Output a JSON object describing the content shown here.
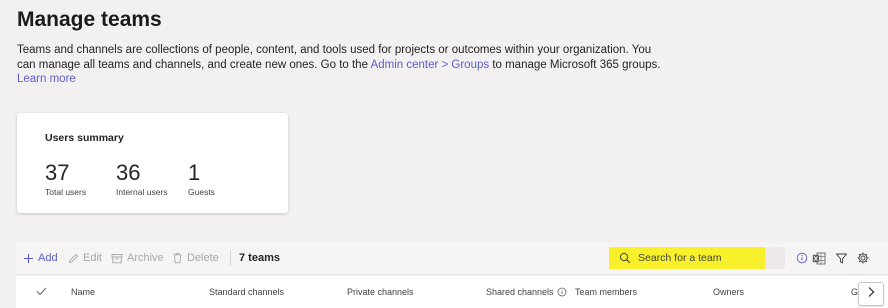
{
  "page": {
    "title": "Manage teams",
    "intro_line1": "Teams and channels are collections of people, content, and tools used for projects or outcomes within your organization. You",
    "intro_line2_pre": "can manage all teams and channels, and create new ones. Go to the ",
    "intro_link": "Admin center > Groups",
    "intro_line2_post": " to manage Microsoft 365 groups.",
    "learn_more": "Learn more"
  },
  "summary": {
    "title": "Users summary",
    "stats": [
      {
        "value": "37",
        "label": "Total users"
      },
      {
        "value": "36",
        "label": "Internal users"
      },
      {
        "value": "1",
        "label": "Guests"
      }
    ]
  },
  "toolbar": {
    "add": "Add",
    "edit": "Edit",
    "archive": "Archive",
    "delete": "Delete",
    "count": "7 teams",
    "search_placeholder": "Search for a team"
  },
  "columns": [
    "Name",
    "Standard channels",
    "Private channels",
    "Shared channels",
    "Team members",
    "Owners",
    "G"
  ],
  "icons": {
    "add": "plus-icon",
    "edit": "pencil-icon",
    "archive": "archive-icon",
    "delete": "trash-icon",
    "search": "search-icon",
    "info": "info-icon",
    "excel": "excel-export-icon",
    "filter": "filter-icon",
    "settings": "gear-icon",
    "select_all": "checkmark-icon",
    "scroll": "chevron-right-icon"
  },
  "colors": {
    "accent": "#5b5fc7",
    "highlight": "#f7f02a",
    "background": "#f3f0f1"
  }
}
